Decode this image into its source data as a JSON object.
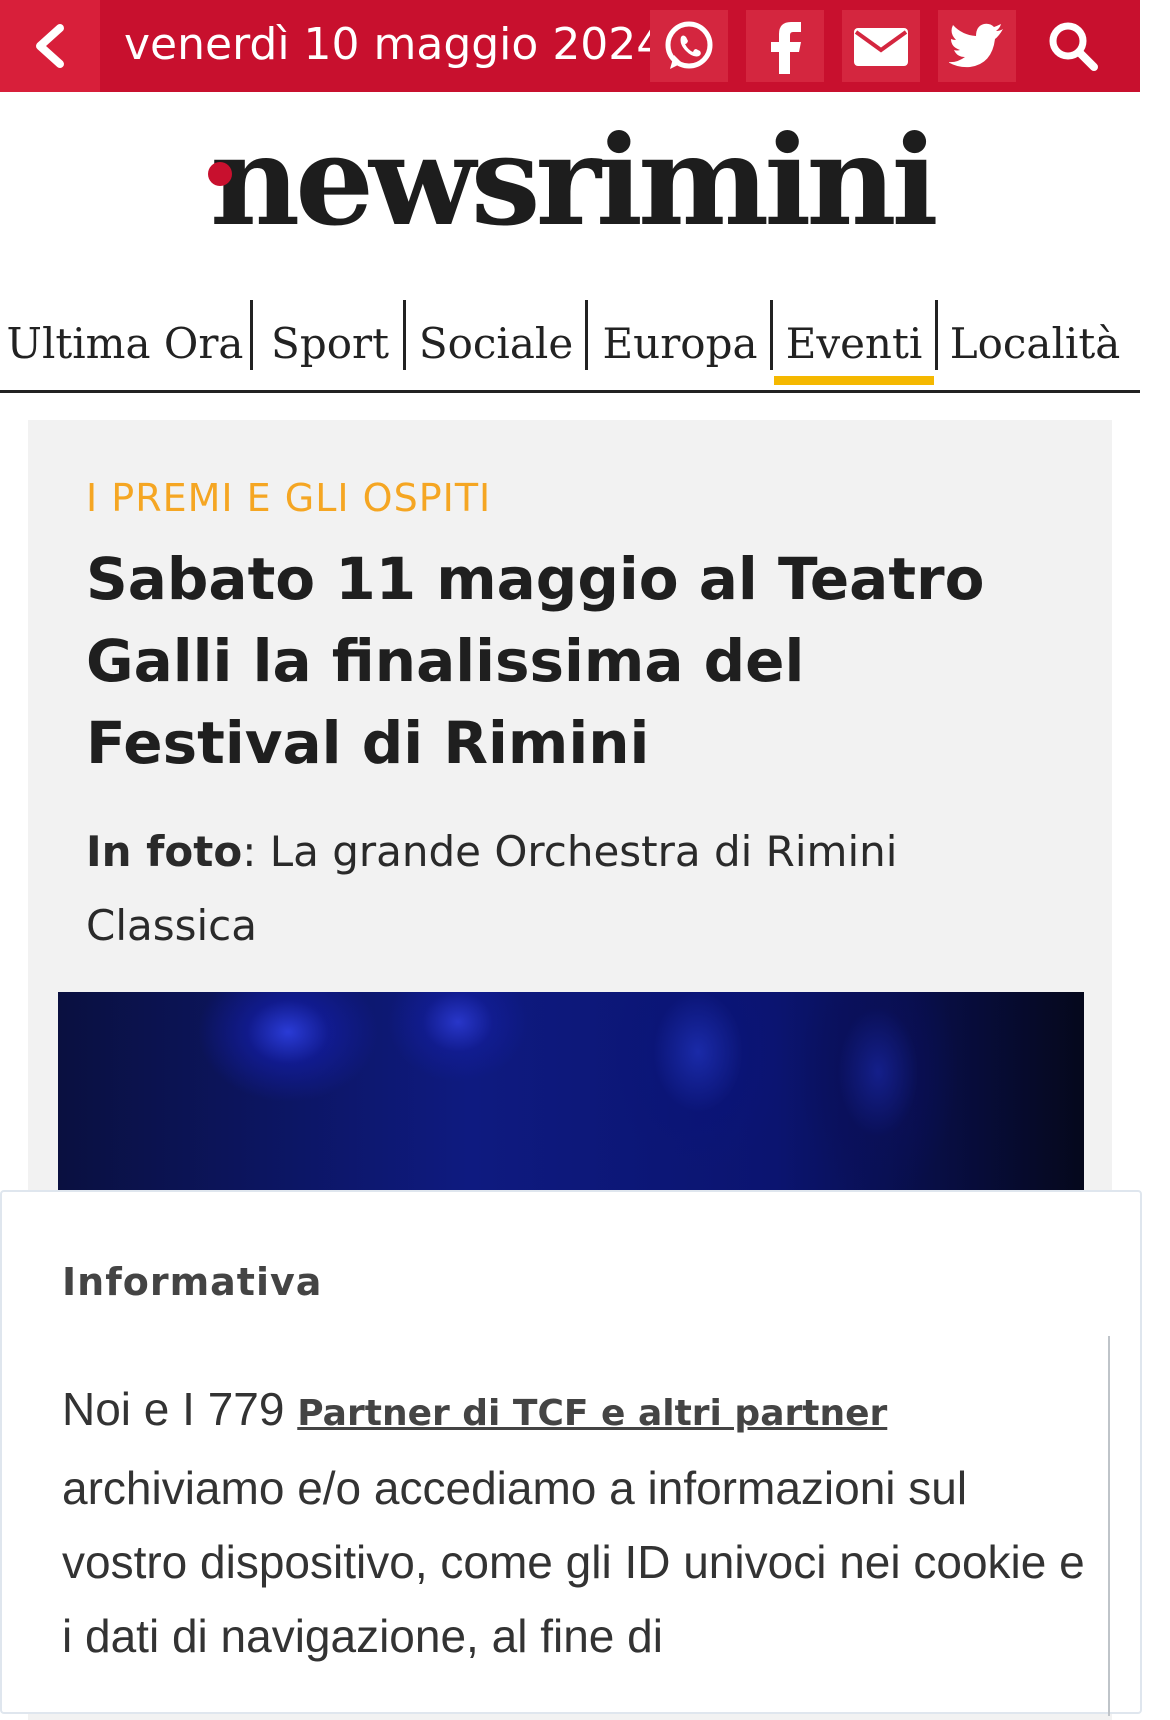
{
  "topbar": {
    "date": "venerdì 10 maggio 2024",
    "icons": [
      "chevron-left-icon",
      "whatsapp-icon",
      "facebook-icon",
      "mail-icon",
      "twitter-icon",
      "search-icon"
    ],
    "bg_color": "#c8102e"
  },
  "logo": {
    "text": "newsrimini",
    "accent_color": "#c8102e"
  },
  "nav": {
    "items": [
      "Ultima Ora",
      "Sport",
      "Sociale",
      "Europa",
      "Eventi",
      "Località"
    ],
    "active": "Eventi",
    "active_color": "#f5b800"
  },
  "article": {
    "kicker": "I PREMI E GLI OSPITI",
    "kicker_color": "#f5a623",
    "headline": "Sabato 11 maggio al Teatro Galli la finalissima del Festival di Rimini",
    "caption_label": "In foto",
    "caption_text": ": La grande Orchestra di Rimini Classica"
  },
  "consent": {
    "title": "Informativa",
    "text_prefix": "Noi e I 779 ",
    "link": "Partner di TCF e altri partner",
    "text_suffix": " archiviamo e/o accediamo a informazioni sul vostro dispositivo, come gli ID univoci nei cookie e i dati di navigazione, al fine di"
  }
}
